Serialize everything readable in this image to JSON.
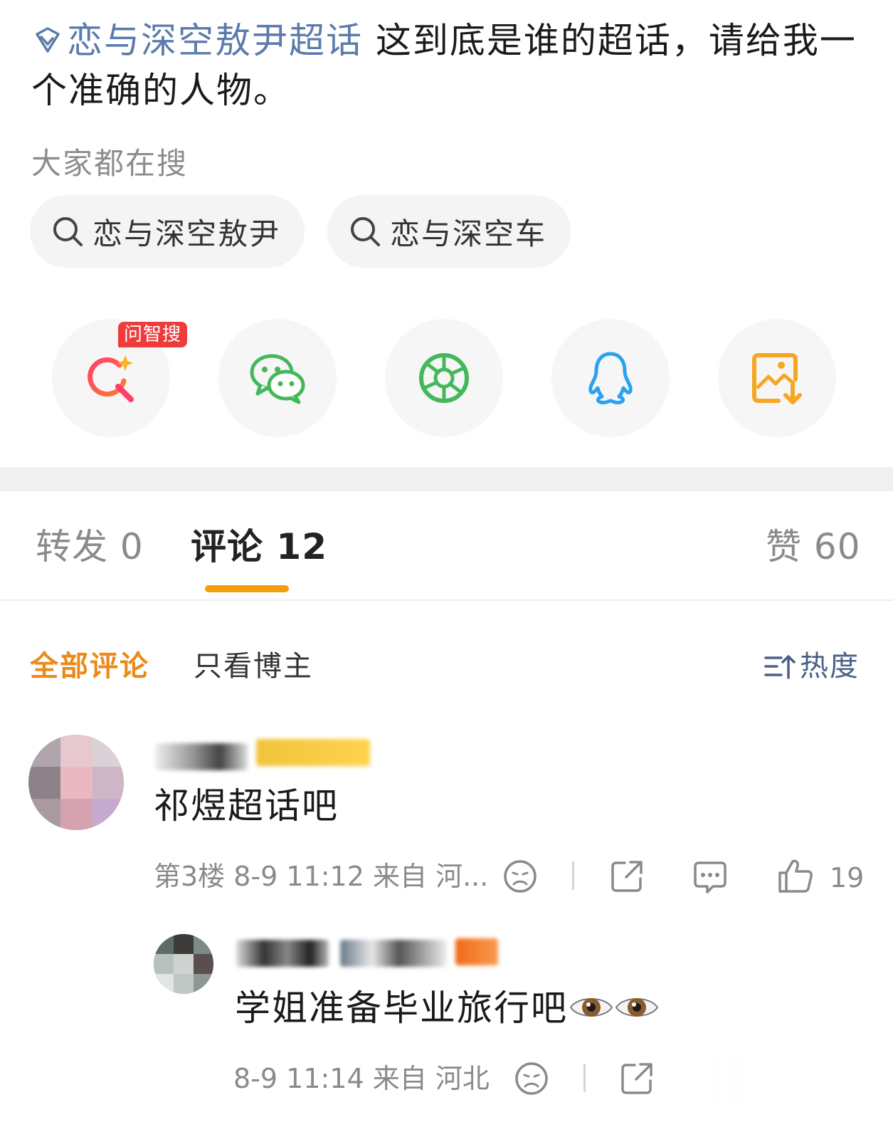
{
  "post": {
    "topic_name": "恋与深空敖尹超话",
    "body": " 这到底是谁的超话，请给我一个准确的人物。"
  },
  "search": {
    "title": "大家都在搜",
    "chips": [
      "恋与深空敖尹",
      "恋与深空车"
    ]
  },
  "share": {
    "badge": "问智搜",
    "items": [
      "ai-search-icon",
      "wechat-icon",
      "moments-icon",
      "qq-icon",
      "save-image-icon"
    ]
  },
  "tabs": {
    "repost": "转发 0",
    "comments": "评论 12",
    "likes": "赞 60"
  },
  "filters": {
    "all": "全部评论",
    "author_only": "只看博主",
    "sort": "热度"
  },
  "comments": [
    {
      "text": "祁煜超话吧",
      "meta": "第3楼 8-9 11:12 来自 河...",
      "likes": "19"
    },
    {
      "text": "学姐准备毕业旅行吧",
      "meta": "8-9 11:14 来自 河北"
    }
  ],
  "colors": {
    "accent": "#f59e0b",
    "link": "#5b7bab",
    "active_filter": "#ea8a1a",
    "badge": "#ee3b3b"
  }
}
